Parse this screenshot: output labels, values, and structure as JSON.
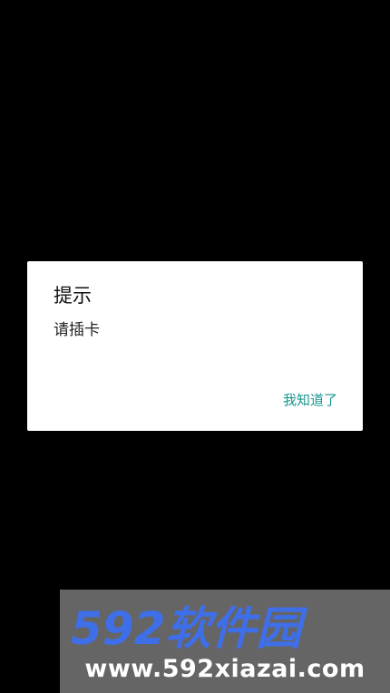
{
  "dialog": {
    "title": "提示",
    "message": "请插卡",
    "confirm_label": "我知道了"
  },
  "watermark": {
    "logo_text": "592软件园",
    "url": "www.592xiazai.com"
  },
  "colors": {
    "background": "#000000",
    "dialog_bg": "#ffffff",
    "accent": "#16968d",
    "logo_blue": "#3f6fe8"
  }
}
